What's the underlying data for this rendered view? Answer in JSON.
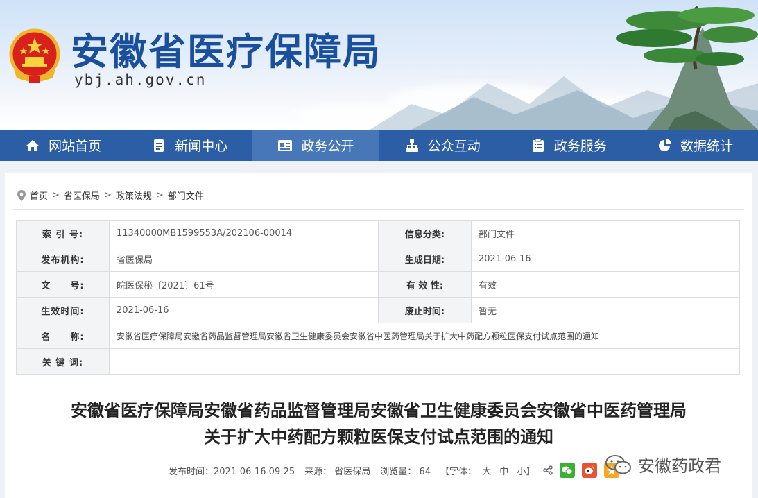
{
  "header": {
    "site_title": "安徽省医疗保障局",
    "site_url": "ybj.ah.gov.cn"
  },
  "nav": {
    "items": [
      {
        "label": "网站首页",
        "icon": "home-icon"
      },
      {
        "label": "新闻中心",
        "icon": "document-icon"
      },
      {
        "label": "政务公开",
        "icon": "board-icon",
        "active": true
      },
      {
        "label": "公众互动",
        "icon": "network-icon"
      },
      {
        "label": "政务服务",
        "icon": "clipboard-icon"
      },
      {
        "label": "数据统计",
        "icon": "pie-icon"
      }
    ]
  },
  "breadcrumb": {
    "items": [
      "首页",
      "省医保局",
      "政策法规",
      "部门文件"
    ],
    "separator": ">"
  },
  "meta": {
    "rows": [
      {
        "k1": "索 引 号:",
        "v1": "11340000MB1599553A/202106-00014",
        "k2": "信息分类:",
        "v2": "部门文件"
      },
      {
        "k1": "发布机构:",
        "v1": "省医保局",
        "k2": "生成日期:",
        "v2": "2021-06-16"
      },
      {
        "k1": "文　　号:",
        "v1": "皖医保秘〔2021〕61号",
        "k2": "有 效 性:",
        "v2": "有效"
      },
      {
        "k1": "生效时间:",
        "v1": "2021-06-16",
        "k2": "废止时间:",
        "v2": "暂无"
      }
    ],
    "name_key": "名　　称:",
    "name_value": "安徽省医疗保障局安徽省药品监督管理局安徽省卫生健康委员会安徽省中医药管理局关于扩大中药配方颗粒医保支付试点范围的通知",
    "keywords_key": "关 键 词:",
    "keywords_value": ""
  },
  "document": {
    "title_line1": "安徽省医疗保障局安徽省药品监督管理局安徽省卫生健康委员会安徽省中医药管理局",
    "title_line2": "关于扩大中药配方颗粒医保支付试点范围的通知",
    "publish_time": "发布时间：2021-06-16 09:25",
    "source": "来源：  省医保局",
    "views": "浏览量：  64",
    "font_label": "【字体：",
    "font_large": "大",
    "font_medium": "中",
    "font_small": "小】"
  },
  "watermark": {
    "text": "安徽药政君"
  },
  "colors": {
    "nav_bg": "#2c5ea6",
    "nav_active": "#4777b9",
    "title_blue": "#1a4f9c",
    "wechat": "#3cb034",
    "weibo": "#e8542f",
    "favorite": "#f5a623"
  }
}
